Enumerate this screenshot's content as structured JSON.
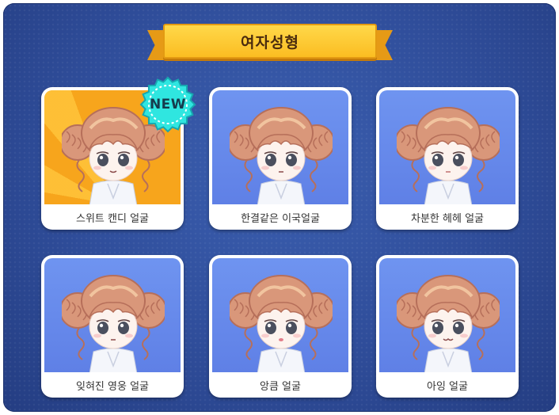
{
  "title": "여자성형",
  "badge": "NEW",
  "items": [
    {
      "label": "스위트 캔디 얼굴",
      "new": true,
      "mouth": "smile-small"
    },
    {
      "label": "한결같은 이국얼굴",
      "new": false,
      "mouth": "neutral"
    },
    {
      "label": "차분한 헤헤 얼굴",
      "new": false,
      "mouth": "small"
    },
    {
      "label": "잊혀진 영웅 얼굴",
      "new": false,
      "mouth": "neutral"
    },
    {
      "label": "앙큼 얼굴",
      "new": false,
      "mouth": "pout"
    },
    {
      "label": "아잉 얼굴",
      "new": false,
      "mouth": "cat"
    }
  ],
  "colors": {
    "background": "#2f4d9a",
    "ribbon": "#fbbd22",
    "card_bg": "#5f80e6",
    "featured_bg": "#f7a51c",
    "badge": "#2fe6e0"
  }
}
